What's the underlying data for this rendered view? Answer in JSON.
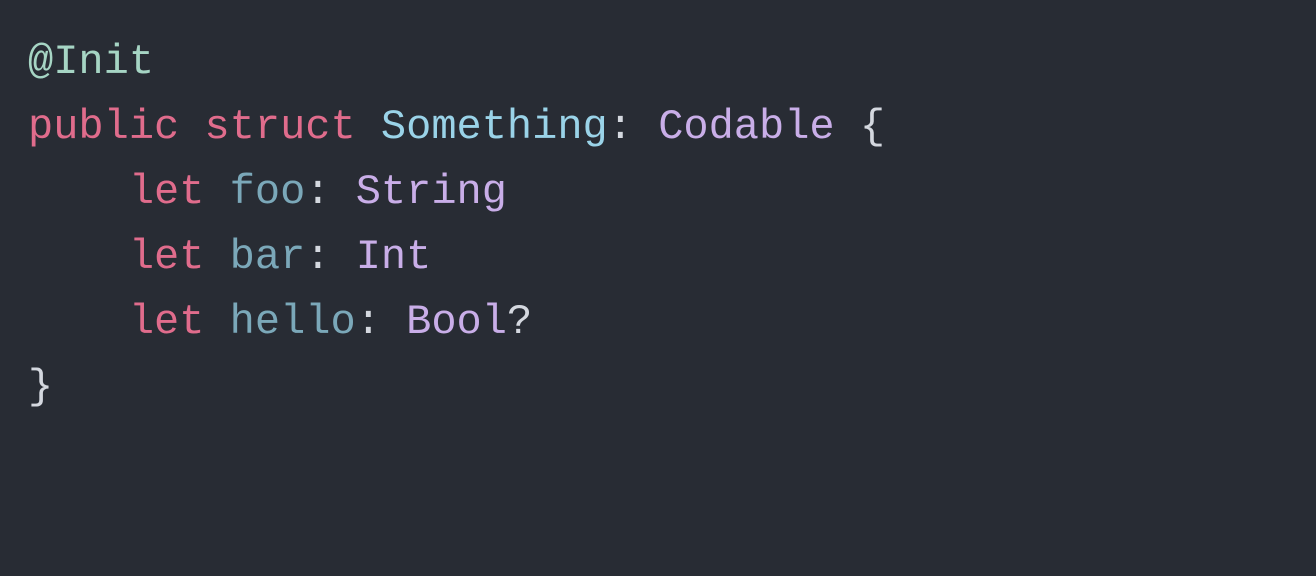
{
  "code": {
    "line1": {
      "attribute": "@Init"
    },
    "line2": {
      "kw_public": "public",
      "kw_struct": "struct",
      "type_name": "Something",
      "colon": ":",
      "protocol": "Codable",
      "brace_open": "{"
    },
    "line3": {
      "kw_let": "let",
      "ident": "foo",
      "colon": ":",
      "type": "String"
    },
    "line4": {
      "kw_let": "let",
      "ident": "bar",
      "colon": ":",
      "type": "Int"
    },
    "line5": {
      "kw_let": "let",
      "ident": "hello",
      "colon": ":",
      "type": "Bool",
      "optional": "?"
    },
    "line6": {
      "brace_close": "}"
    }
  }
}
